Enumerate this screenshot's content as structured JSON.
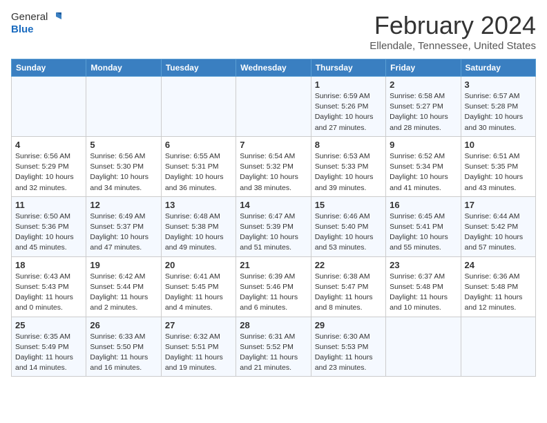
{
  "app": {
    "name_general": "General",
    "name_blue": "Blue"
  },
  "header": {
    "month": "February 2024",
    "location": "Ellendale, Tennessee, United States"
  },
  "weekdays": [
    "Sunday",
    "Monday",
    "Tuesday",
    "Wednesday",
    "Thursday",
    "Friday",
    "Saturday"
  ],
  "weeks": [
    [
      {
        "day": "",
        "sunrise": "",
        "sunset": "",
        "daylight": ""
      },
      {
        "day": "",
        "sunrise": "",
        "sunset": "",
        "daylight": ""
      },
      {
        "day": "",
        "sunrise": "",
        "sunset": "",
        "daylight": ""
      },
      {
        "day": "",
        "sunrise": "",
        "sunset": "",
        "daylight": ""
      },
      {
        "day": "1",
        "sunrise": "Sunrise: 6:59 AM",
        "sunset": "Sunset: 5:26 PM",
        "daylight": "Daylight: 10 hours and 27 minutes."
      },
      {
        "day": "2",
        "sunrise": "Sunrise: 6:58 AM",
        "sunset": "Sunset: 5:27 PM",
        "daylight": "Daylight: 10 hours and 28 minutes."
      },
      {
        "day": "3",
        "sunrise": "Sunrise: 6:57 AM",
        "sunset": "Sunset: 5:28 PM",
        "daylight": "Daylight: 10 hours and 30 minutes."
      }
    ],
    [
      {
        "day": "4",
        "sunrise": "Sunrise: 6:56 AM",
        "sunset": "Sunset: 5:29 PM",
        "daylight": "Daylight: 10 hours and 32 minutes."
      },
      {
        "day": "5",
        "sunrise": "Sunrise: 6:56 AM",
        "sunset": "Sunset: 5:30 PM",
        "daylight": "Daylight: 10 hours and 34 minutes."
      },
      {
        "day": "6",
        "sunrise": "Sunrise: 6:55 AM",
        "sunset": "Sunset: 5:31 PM",
        "daylight": "Daylight: 10 hours and 36 minutes."
      },
      {
        "day": "7",
        "sunrise": "Sunrise: 6:54 AM",
        "sunset": "Sunset: 5:32 PM",
        "daylight": "Daylight: 10 hours and 38 minutes."
      },
      {
        "day": "8",
        "sunrise": "Sunrise: 6:53 AM",
        "sunset": "Sunset: 5:33 PM",
        "daylight": "Daylight: 10 hours and 39 minutes."
      },
      {
        "day": "9",
        "sunrise": "Sunrise: 6:52 AM",
        "sunset": "Sunset: 5:34 PM",
        "daylight": "Daylight: 10 hours and 41 minutes."
      },
      {
        "day": "10",
        "sunrise": "Sunrise: 6:51 AM",
        "sunset": "Sunset: 5:35 PM",
        "daylight": "Daylight: 10 hours and 43 minutes."
      }
    ],
    [
      {
        "day": "11",
        "sunrise": "Sunrise: 6:50 AM",
        "sunset": "Sunset: 5:36 PM",
        "daylight": "Daylight: 10 hours and 45 minutes."
      },
      {
        "day": "12",
        "sunrise": "Sunrise: 6:49 AM",
        "sunset": "Sunset: 5:37 PM",
        "daylight": "Daylight: 10 hours and 47 minutes."
      },
      {
        "day": "13",
        "sunrise": "Sunrise: 6:48 AM",
        "sunset": "Sunset: 5:38 PM",
        "daylight": "Daylight: 10 hours and 49 minutes."
      },
      {
        "day": "14",
        "sunrise": "Sunrise: 6:47 AM",
        "sunset": "Sunset: 5:39 PM",
        "daylight": "Daylight: 10 hours and 51 minutes."
      },
      {
        "day": "15",
        "sunrise": "Sunrise: 6:46 AM",
        "sunset": "Sunset: 5:40 PM",
        "daylight": "Daylight: 10 hours and 53 minutes."
      },
      {
        "day": "16",
        "sunrise": "Sunrise: 6:45 AM",
        "sunset": "Sunset: 5:41 PM",
        "daylight": "Daylight: 10 hours and 55 minutes."
      },
      {
        "day": "17",
        "sunrise": "Sunrise: 6:44 AM",
        "sunset": "Sunset: 5:42 PM",
        "daylight": "Daylight: 10 hours and 57 minutes."
      }
    ],
    [
      {
        "day": "18",
        "sunrise": "Sunrise: 6:43 AM",
        "sunset": "Sunset: 5:43 PM",
        "daylight": "Daylight: 11 hours and 0 minutes."
      },
      {
        "day": "19",
        "sunrise": "Sunrise: 6:42 AM",
        "sunset": "Sunset: 5:44 PM",
        "daylight": "Daylight: 11 hours and 2 minutes."
      },
      {
        "day": "20",
        "sunrise": "Sunrise: 6:41 AM",
        "sunset": "Sunset: 5:45 PM",
        "daylight": "Daylight: 11 hours and 4 minutes."
      },
      {
        "day": "21",
        "sunrise": "Sunrise: 6:39 AM",
        "sunset": "Sunset: 5:46 PM",
        "daylight": "Daylight: 11 hours and 6 minutes."
      },
      {
        "day": "22",
        "sunrise": "Sunrise: 6:38 AM",
        "sunset": "Sunset: 5:47 PM",
        "daylight": "Daylight: 11 hours and 8 minutes."
      },
      {
        "day": "23",
        "sunrise": "Sunrise: 6:37 AM",
        "sunset": "Sunset: 5:48 PM",
        "daylight": "Daylight: 11 hours and 10 minutes."
      },
      {
        "day": "24",
        "sunrise": "Sunrise: 6:36 AM",
        "sunset": "Sunset: 5:48 PM",
        "daylight": "Daylight: 11 hours and 12 minutes."
      }
    ],
    [
      {
        "day": "25",
        "sunrise": "Sunrise: 6:35 AM",
        "sunset": "Sunset: 5:49 PM",
        "daylight": "Daylight: 11 hours and 14 minutes."
      },
      {
        "day": "26",
        "sunrise": "Sunrise: 6:33 AM",
        "sunset": "Sunset: 5:50 PM",
        "daylight": "Daylight: 11 hours and 16 minutes."
      },
      {
        "day": "27",
        "sunrise": "Sunrise: 6:32 AM",
        "sunset": "Sunset: 5:51 PM",
        "daylight": "Daylight: 11 hours and 19 minutes."
      },
      {
        "day": "28",
        "sunrise": "Sunrise: 6:31 AM",
        "sunset": "Sunset: 5:52 PM",
        "daylight": "Daylight: 11 hours and 21 minutes."
      },
      {
        "day": "29",
        "sunrise": "Sunrise: 6:30 AM",
        "sunset": "Sunset: 5:53 PM",
        "daylight": "Daylight: 11 hours and 23 minutes."
      },
      {
        "day": "",
        "sunrise": "",
        "sunset": "",
        "daylight": ""
      },
      {
        "day": "",
        "sunrise": "",
        "sunset": "",
        "daylight": ""
      }
    ]
  ]
}
